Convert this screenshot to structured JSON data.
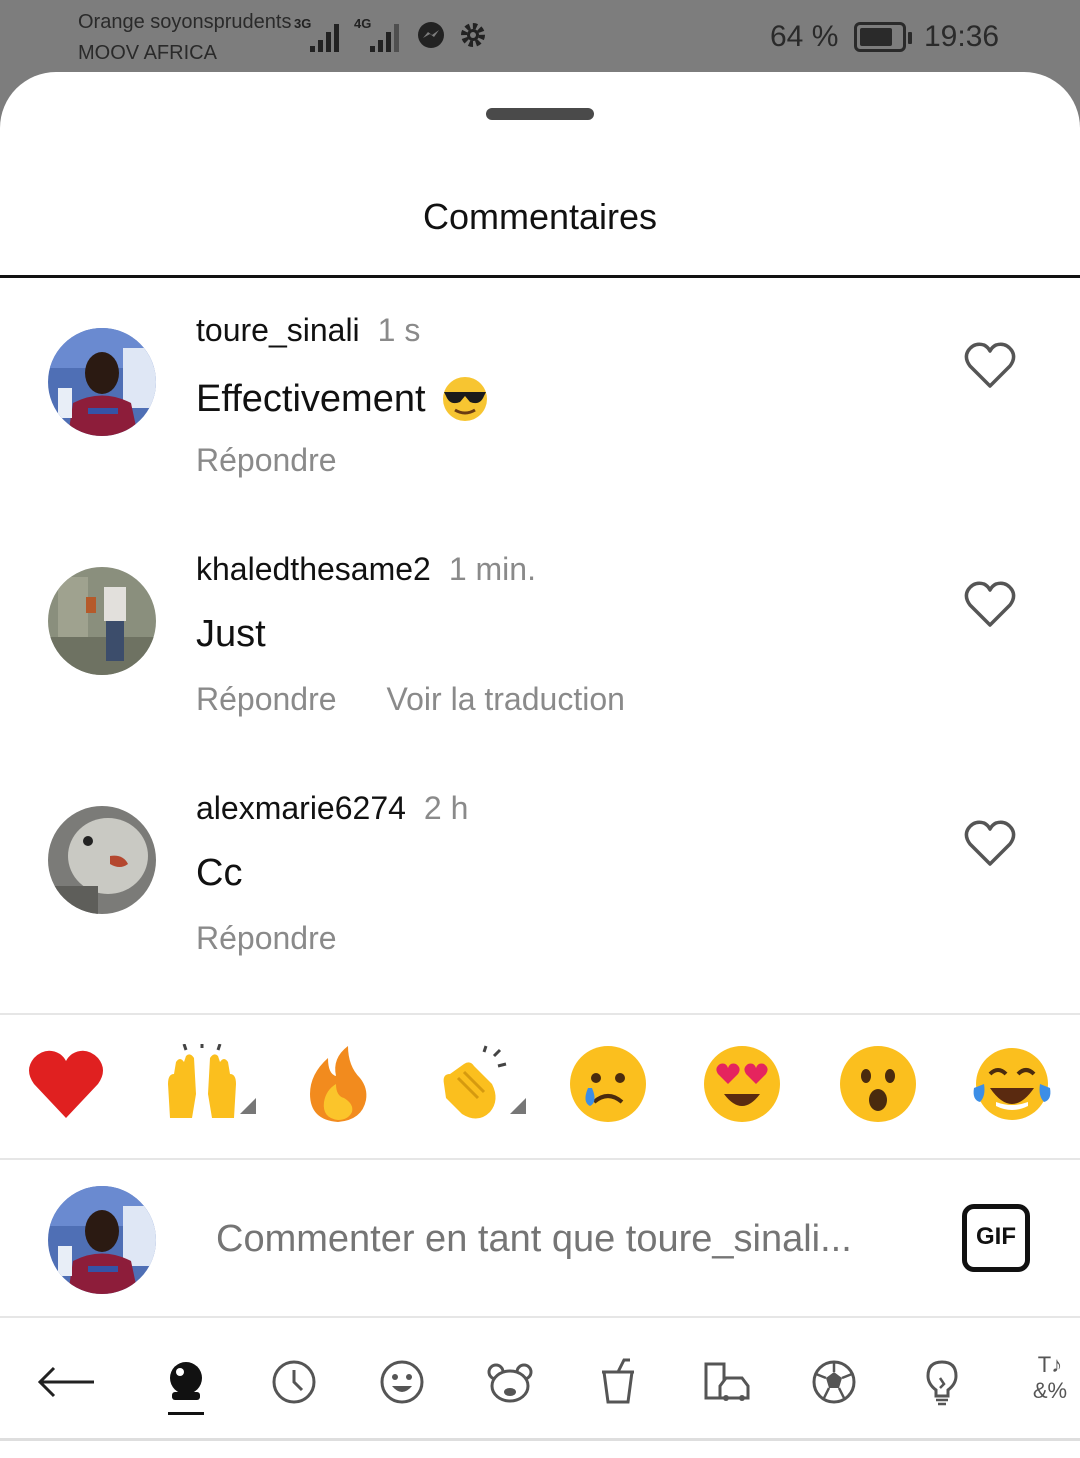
{
  "status_bar": {
    "carrier_line1": "Orange soyonsprudents",
    "carrier_line2": "MOOV AFRICA",
    "signal1_label": "3G",
    "signal2_label": "4G",
    "battery_percent": "64 %",
    "time": "19:36",
    "icons": [
      "messenger-icon",
      "gear-icon",
      "battery-icon"
    ]
  },
  "sheet": {
    "title": "Commentaires"
  },
  "comments": [
    {
      "username": "toure_sinali",
      "time": "1 s",
      "text": "Effectivement",
      "emoji": "smiling-face-with-sunglasses",
      "actions": [
        "Répondre"
      ]
    },
    {
      "username": "khaledthesame2",
      "time": "1 min.",
      "text": "Just",
      "actions": [
        "Répondre",
        "Voir la traduction"
      ]
    },
    {
      "username": "alexmarie6274",
      "time": "2 h",
      "text": "Cc",
      "actions": [
        "Répondre"
      ]
    }
  ],
  "quick_reactions": [
    "red-heart",
    "raising-hands",
    "fire",
    "clapping-hands",
    "crying-face",
    "heart-eyes",
    "astonished-face",
    "tears-of-joy"
  ],
  "composer": {
    "placeholder": "Commenter en tant que toure_sinali...",
    "gif_label": "GIF"
  },
  "emoji_keyboard": {
    "tabs": [
      "back-arrow-icon",
      "sticker-icon",
      "recent-icon",
      "smiley-icon",
      "animal-icon",
      "food-icon",
      "travel-icon",
      "activity-icon",
      "objects-icon",
      "symbols-icon"
    ],
    "symbols_label_top": "T♪",
    "symbols_label_bottom": "&%"
  },
  "colors": {
    "status_bar_bg": "#7d7d7d",
    "secondary_text": "#8a8a8a",
    "placeholder": "#c4c4c4"
  }
}
